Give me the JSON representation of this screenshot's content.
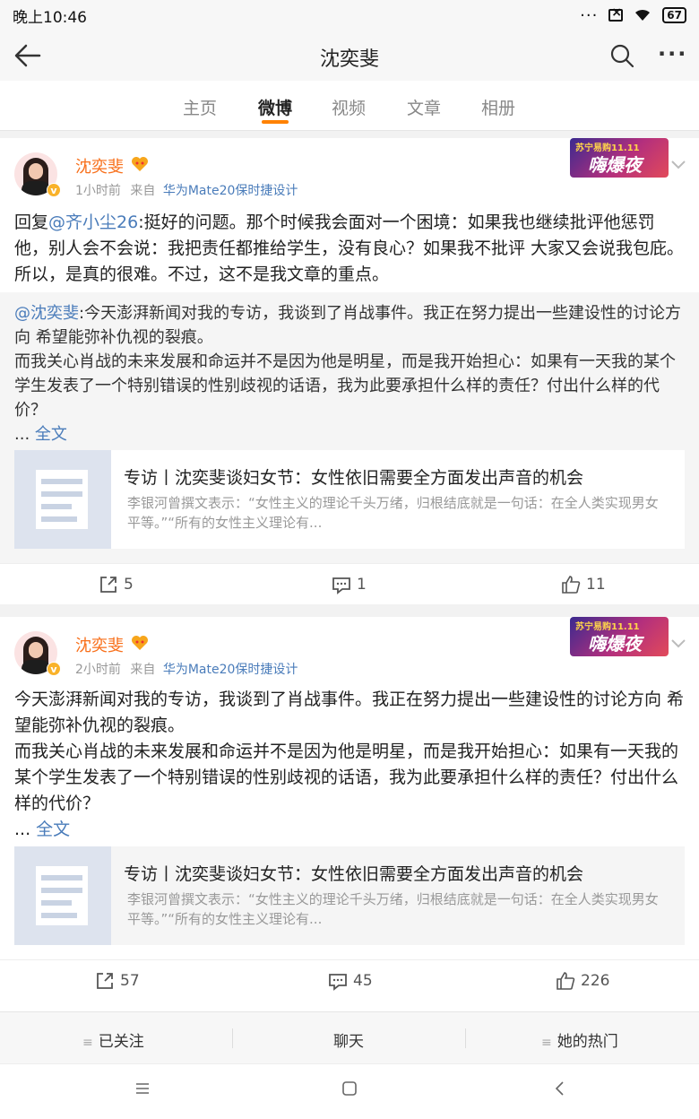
{
  "status_bar": {
    "time": "晚上10:46",
    "battery": "67"
  },
  "header": {
    "title": "沈奕斐"
  },
  "tabs": [
    "主页",
    "微博",
    "视频",
    "文章",
    "相册"
  ],
  "active_tab": "微博",
  "posts": [
    {
      "username": "沈奕斐",
      "time": "1小时前",
      "from": "来自",
      "source": "华为Mate20保时捷设计",
      "banner": "苏宁易购11.11 嗨爆夜",
      "reply_prefix": "回复",
      "mention": "@齐小尘26",
      "body": ":挺好的问题。那个时候我会面对一个困境：如果我也继续批评他惩罚他，别人会不会说：我把责任都推给学生，没有良心？如果我不批评 大家又会说我包庇。所以，是真的很难。不过，这不是我文章的重点。",
      "quote": {
        "mention": "@沈奕斐",
        "text": ":今天澎湃新闻对我的专访，我谈到了肖战事件。我正在努力提出一些建设性的讨论方向 希望能弥补仇视的裂痕。\n而我关心肖战的未来发展和命运并不是因为他是明星，而是我开始担心：如果有一天我的某个学生发表了一个特别错误的性别歧视的话语，我为此要承担什么样的责任？付出什么样的代价？",
        "ellipsis": "...",
        "full_text_link": "全文",
        "article_title": "专访丨沈奕斐谈妇女节：女性依旧需要全方面发出声音的机会",
        "article_desc": "李银河曾撰文表示：“女性主义的理论千头万绪，归根结底就是一句话：在全人类实现男女平等。”“所有的女性主义理论有..."
      },
      "reposts": "5",
      "comments": "1",
      "likes": "11"
    },
    {
      "username": "沈奕斐",
      "time": "2小时前",
      "from": "来自",
      "source": "华为Mate20保时捷设计",
      "banner": "苏宁易购11.11 嗨爆夜",
      "body": "今天澎湃新闻对我的专访，我谈到了肖战事件。我正在努力提出一些建设性的讨论方向 希望能弥补仇视的裂痕。\n而我关心肖战的未来发展和命运并不是因为他是明星，而是我开始担心：如果有一天我的某个学生发表了一个特别错误的性别歧视的话语，我为此要承担什么样的责任？付出什么样的代价？",
      "ellipsis": "...",
      "full_text_link": "全文",
      "article_title": "专访丨沈奕斐谈妇女节：女性依旧需要全方面发出声音的机会",
      "article_desc": "李银河曾撰文表示：“女性主义的理论千头万绪，归根结底就是一句话：在全人类实现男女平等。”“所有的女性主义理论有...",
      "reposts": "57",
      "comments": "45",
      "likes": "226"
    }
  ],
  "bottom_bar": {
    "follow": "已关注",
    "chat": "聊天",
    "hot": "她的热门"
  },
  "colors": {
    "accent": "#ff8200",
    "username": "#f86f1a",
    "link": "#4a7cba"
  },
  "icons": [
    "back-arrow-icon",
    "search-icon",
    "more-icon",
    "verified-icon",
    "heart-icon",
    "chevron-down-icon",
    "repost-icon",
    "comment-icon",
    "like-icon",
    "menu-icon",
    "home-square-icon",
    "nav-back-icon"
  ]
}
